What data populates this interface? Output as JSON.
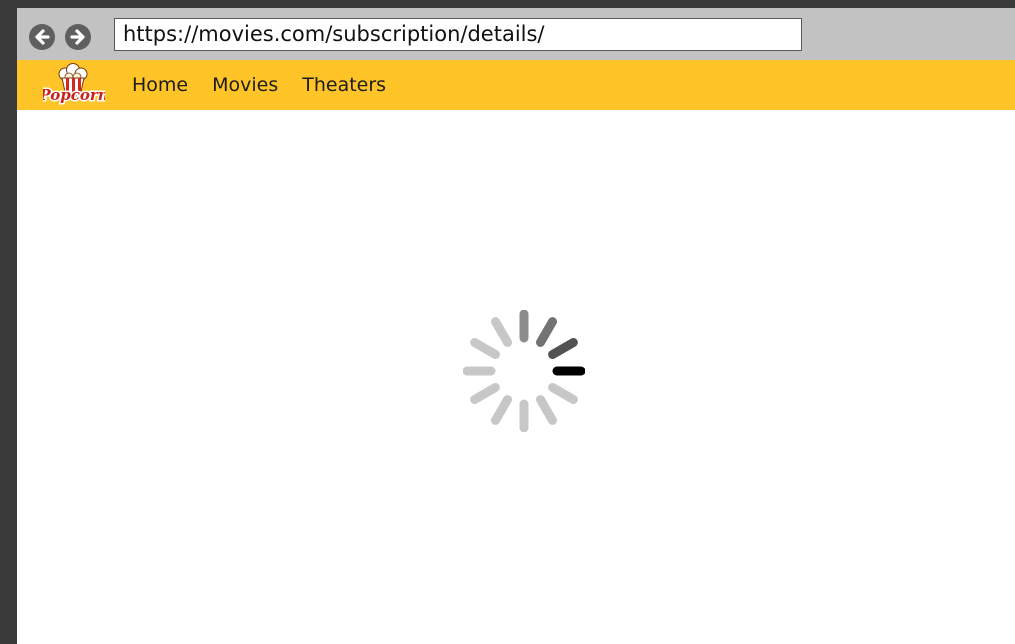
{
  "browser": {
    "url": "https://movies.com/subscription/details/",
    "back_icon": "arrow-left-icon",
    "forward_icon": "arrow-right-icon"
  },
  "site": {
    "logo_text": "Popcorn",
    "brand_color": "#fec428",
    "nav": [
      {
        "label": "Home"
      },
      {
        "label": "Movies"
      },
      {
        "label": "Theaters"
      }
    ]
  },
  "content": {
    "state": "loading",
    "spinner_icon": "loading-spinner-icon"
  }
}
